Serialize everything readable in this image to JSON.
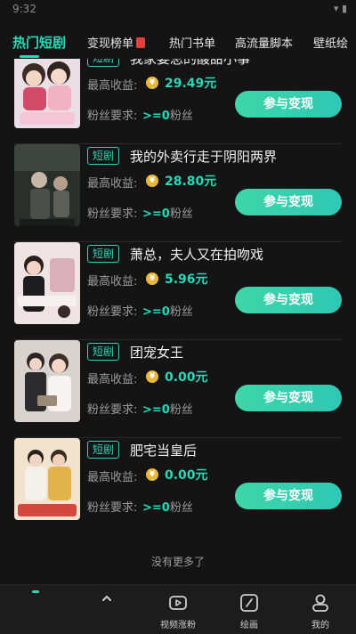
{
  "status": {
    "time": "9:32",
    "icons": "▾ ▮"
  },
  "tabs": [
    {
      "label": "热门短剧",
      "active": true
    },
    {
      "label": "变现榜单"
    },
    {
      "label": "热门书单"
    },
    {
      "label": "高流量脚本"
    },
    {
      "label": "壁纸绘"
    }
  ],
  "items": [
    {
      "tag": "短剧",
      "title": "我家姜总的酸甜小事",
      "earn_label": "最高收益:",
      "earn_value": "29.49元",
      "fans_label": "粉丝要求:",
      "fans_value": ">=0",
      "fans_unit": "粉丝",
      "button": "参与变现"
    },
    {
      "tag": "短剧",
      "title": "我的外卖行走于阴阳两界",
      "earn_label": "最高收益:",
      "earn_value": "28.80元",
      "fans_label": "粉丝要求:",
      "fans_value": ">=0",
      "fans_unit": "粉丝",
      "button": "参与变现"
    },
    {
      "tag": "短剧",
      "title": "萧总，夫人又在拍吻戏",
      "earn_label": "最高收益:",
      "earn_value": "5.96元",
      "fans_label": "粉丝要求:",
      "fans_value": ">=0",
      "fans_unit": "粉丝",
      "button": "参与变现"
    },
    {
      "tag": "短剧",
      "title": "团宠女王",
      "earn_label": "最高收益:",
      "earn_value": "0.00元",
      "fans_label": "粉丝要求:",
      "fans_value": ">=0",
      "fans_unit": "粉丝",
      "button": "参与变现"
    },
    {
      "tag": "短剧",
      "title": "肥宅当皇后",
      "earn_label": "最高收益:",
      "earn_value": "0.00元",
      "fans_label": "粉丝要求:",
      "fans_value": ">=0",
      "fans_unit": "粉丝",
      "button": "参与变现"
    }
  ],
  "list_footer": "没有更多了",
  "coin_icon": "coin-icon",
  "bottom_nav": [
    {
      "label": "",
      "icon": "home-icon"
    },
    {
      "label": "",
      "icon": "up-arrow-icon"
    },
    {
      "label": "视频涨粉",
      "icon": "video-play-icon"
    },
    {
      "label": "绘画",
      "icon": "pencil-icon"
    },
    {
      "label": "我的",
      "icon": "user-icon"
    }
  ],
  "colors": {
    "accent": "#29d8b8",
    "background": "#141414",
    "coin": "#e9b83b"
  }
}
